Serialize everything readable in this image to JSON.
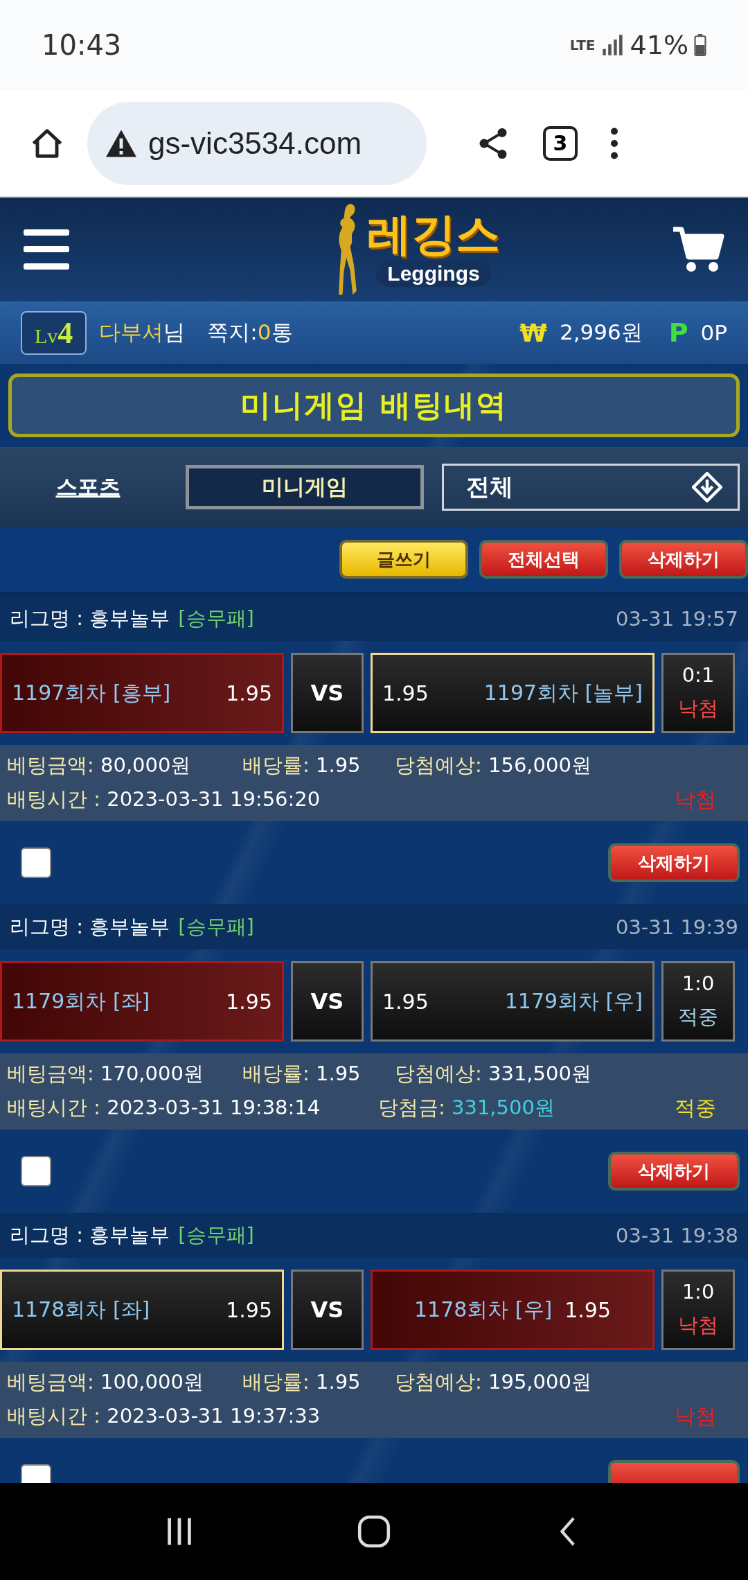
{
  "status_bar": {
    "time": "10:43",
    "network": "LTE",
    "battery": "41%"
  },
  "browser": {
    "url": "gs-vic3534.com",
    "tab_count": "3"
  },
  "header": {
    "logo_title": "레깅스",
    "logo_subtitle": "Leggings"
  },
  "user_bar": {
    "level": "Lv",
    "level_number": "4",
    "nickname": "다부셔",
    "honorific": "님",
    "messages_label": "쪽지:",
    "messages_count": "0",
    "messages_unit": "통",
    "money_symbol": "₩",
    "money": "2,996원",
    "points_symbol": "P",
    "points": "0P"
  },
  "page_title": "미니게임 배팅내역",
  "tabs": [
    {
      "label": "스포츠",
      "selected": false
    },
    {
      "label": "미니게임",
      "selected": true
    }
  ],
  "filter": {
    "value": "전체"
  },
  "actions": [
    {
      "label": "글쓰기",
      "kind": "primary"
    },
    {
      "label": "전체선택",
      "kind": "danger"
    },
    {
      "label": "삭제하기",
      "kind": "danger"
    }
  ],
  "bets": [
    {
      "league": "리그명 : 흥부놀부",
      "bet_type": "[승무패]",
      "time": "03-31 19:57",
      "home": {
        "name": "1197회차 [흥부]",
        "odds": "1.95",
        "selected": true,
        "kind": "split"
      },
      "vs": "VS",
      "away": {
        "name": "1197회차 [놀부]",
        "odds": "1.95",
        "selected": false,
        "winner": true,
        "kind": "reversed"
      },
      "score": "0:1",
      "result": {
        "text": "낙첨",
        "kind": "lost"
      },
      "status": {
        "text": "낙첨",
        "kind": "lost"
      },
      "amount_label": "베팅금액:",
      "amount": "80,000원",
      "rate_label": "배당률:",
      "rate": "1.95",
      "expected_label": "당첨예상:",
      "expected": "156,000원",
      "time_label": "배팅시간 :",
      "bet_time": "2023-03-31 19:56:20",
      "checked": false,
      "delete_label": "삭제하기"
    },
    {
      "league": "리그명 : 흥부놀부",
      "bet_type": "[승무패]",
      "time": "03-31 19:39",
      "home": {
        "name": "1179회차 [좌]",
        "odds": "1.95",
        "selected": true,
        "kind": "split"
      },
      "vs": "VS",
      "away": {
        "name": "1179회차 [우]",
        "odds": "1.95",
        "selected": false,
        "winner": false,
        "kind": "reversed"
      },
      "score": "1:0",
      "result": {
        "text": "적중",
        "kind": "won"
      },
      "status": {
        "text": "적중",
        "kind": "won"
      },
      "amount_label": "베팅금액:",
      "amount": "170,000원",
      "rate_label": "배당률:",
      "rate": "1.95",
      "expected_label": "당첨예상:",
      "expected": "331,500원",
      "time_label": "배팅시간 :",
      "bet_time": "2023-03-31 19:38:14",
      "payout_label": "당첨금:",
      "payout": "331,500원",
      "checked": false,
      "delete_label": "삭제하기"
    },
    {
      "league": "리그명 : 흥부놀부",
      "bet_type": "[승무패]",
      "time": "03-31 19:38",
      "home": {
        "name": "1178회차 [좌]",
        "odds": "1.95",
        "selected": false,
        "winner": true,
        "kind": "split"
      },
      "vs": "VS",
      "away": {
        "name": "1178회차 [우]",
        "odds": "1.95",
        "selected": true,
        "kind": "centered"
      },
      "score": "1:0",
      "result": {
        "text": "낙첨",
        "kind": "lost"
      },
      "status": {
        "text": "낙첨",
        "kind": "lost"
      },
      "amount_label": "베팅금액:",
      "amount": "100,000원",
      "rate_label": "배당률:",
      "rate": "1.95",
      "expected_label": "당첨예상:",
      "expected": "195,000원",
      "time_label": "배팅시간 :",
      "bet_time": "2023-03-31 19:37:33",
      "checked": false
    }
  ]
}
